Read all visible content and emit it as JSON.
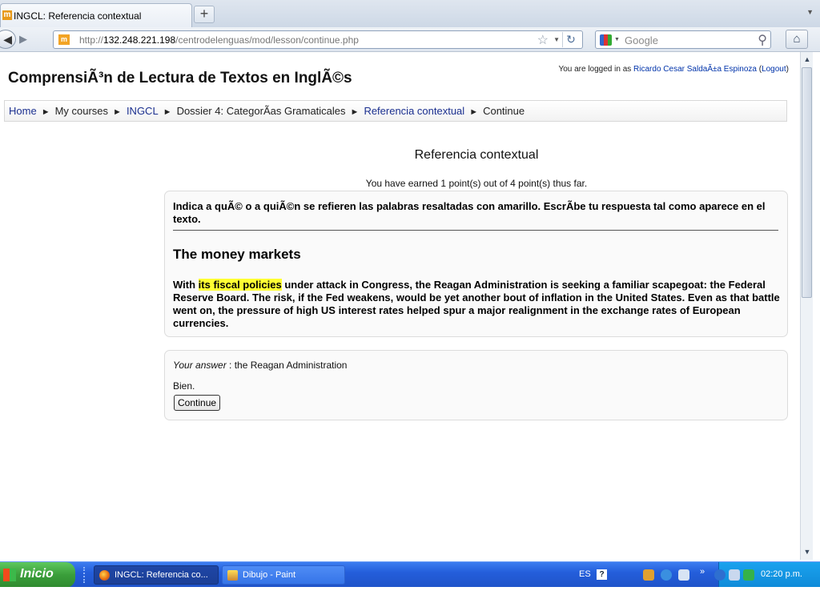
{
  "browser": {
    "tab_title": "INGCL: Referencia contextual",
    "tab_favicon": "m",
    "new_tab_label": "+",
    "url_prefix": "http://",
    "url_host": "132.248.221.198",
    "url_path": "/centrodelenguas/mod/lesson/continue.php",
    "search_placeholder": "Google"
  },
  "header": {
    "site_title": "ComprensiÃ³n de Lectura de Textos en InglÃ©s",
    "login_prefix": "You are logged in as ",
    "user_name": "Ricardo Cesar SaldaÃ±a Espinoza",
    "logout_open": " (",
    "logout_label": "Logout",
    "logout_close": ")"
  },
  "breadcrumb": {
    "home": "Home",
    "my_courses": "My courses",
    "course": "INGCL",
    "section": "Dossier 4: CategorÃas Gramaticales",
    "lesson": "Referencia contextual",
    "current": "Continue",
    "separator": "►"
  },
  "lesson": {
    "title": "Referencia contextual",
    "score_text": "You have earned 1 point(s) out of 4 point(s) thus far.",
    "instructions": "Indica a quÃ© o a quiÃ©n se refieren las palabras resaltadas con amarillo. EscrÃbe tu respuesta tal como aparece en el texto.",
    "article_title": "The money markets",
    "passage_before": "With ",
    "passage_highlight": "its fiscal policies",
    "passage_after": " under attack in Congress, the Reagan Administration is seeking a familiar scapegoat: the Federal Reserve Board. The risk, if the Fed weakens, would be yet another bout of inflation in the United States. Even as that battle went on, the pressure of high US interest rates helped spur a major realignment in the exchange rates of European currencies.",
    "highlight_color": "#ffff33"
  },
  "answer": {
    "label": "Your answer",
    "separator": " : ",
    "value": "the Reagan Administration",
    "feedback": "Bien.",
    "continue_label": "Continue"
  },
  "taskbar": {
    "start_label": "Inicio",
    "task_1": "INGCL: Referencia co...",
    "task_2": "Dibujo - Paint",
    "language": "ES",
    "help": "?",
    "clock": "02:20 p.m."
  },
  "icons": {
    "back": "back-arrow-icon",
    "forward": "forward-arrow-icon",
    "bookmark": "star-icon",
    "reload": "reload-icon",
    "search": "magnifier-icon",
    "home": "home-icon"
  },
  "colors": {
    "link": "#1a2f8f",
    "taskbar": "#245edb",
    "start": "#3a9e3a"
  }
}
